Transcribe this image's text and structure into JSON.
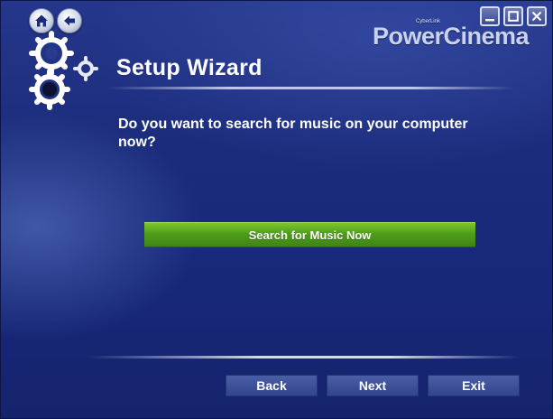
{
  "window": {
    "app_name": "PowerCinema",
    "brand": "CyberLink"
  },
  "header": {
    "title": "Setup Wizard",
    "icons": [
      "home-icon",
      "back-arrow-icon",
      "gears-icon"
    ]
  },
  "window_controls": [
    "minimize-icon",
    "maximize-icon",
    "close-icon"
  ],
  "main": {
    "question": "Do you want to search for music on your computer now?",
    "search_button_label": "Search for Music Now"
  },
  "footer": {
    "back_label": "Back",
    "next_label": "Next",
    "exit_label": "Exit"
  },
  "colors": {
    "background": "#1c2c7c",
    "accent_green": "#4f9d1b",
    "button_blue": "#3f52a0"
  }
}
